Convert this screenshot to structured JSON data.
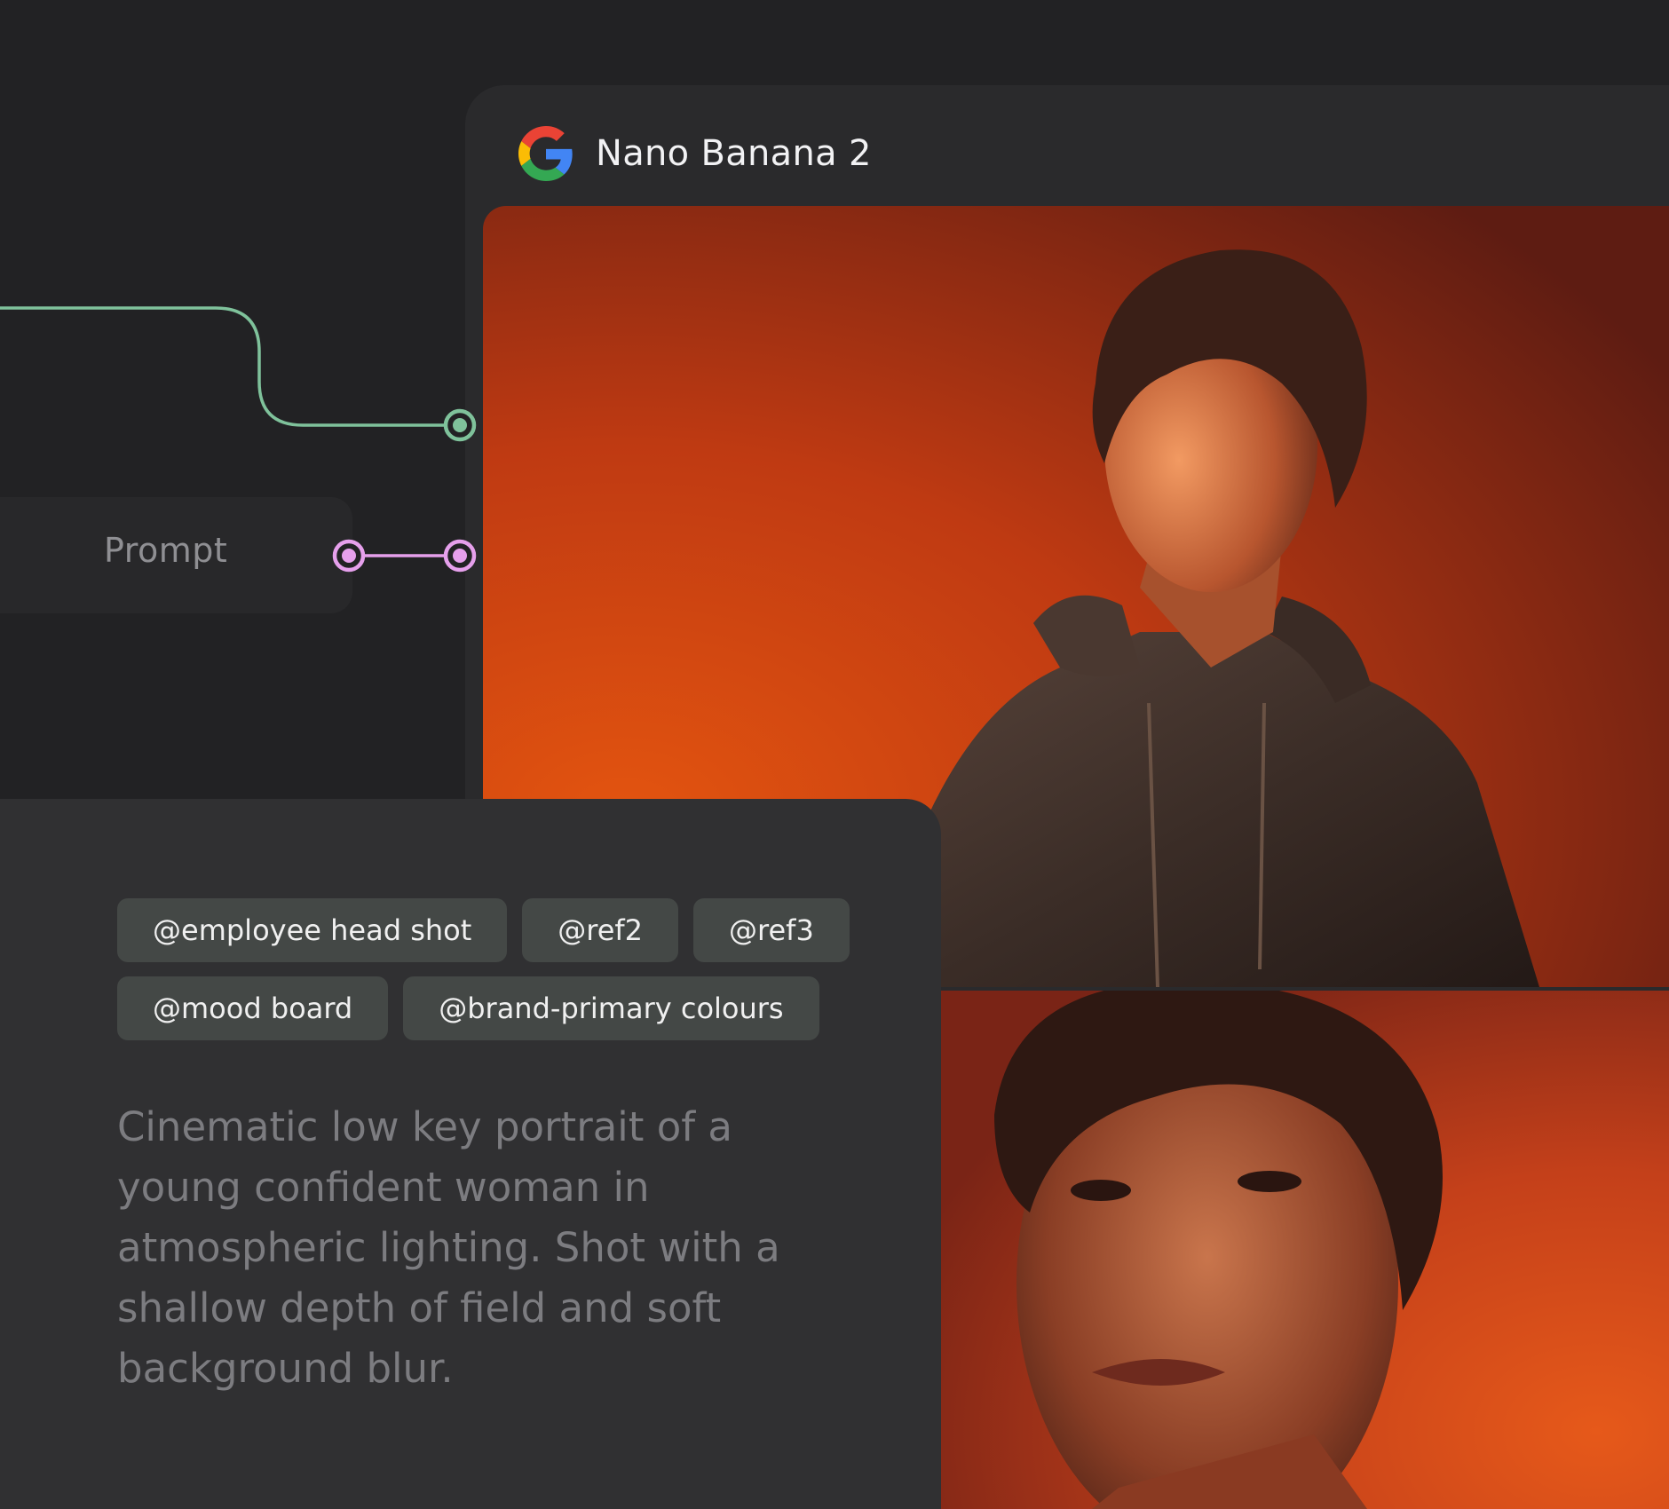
{
  "prompt_node": {
    "label": "Prompt"
  },
  "model_node": {
    "icon": "google-g-icon",
    "title": "Nano Banana 2"
  },
  "prompt_editor": {
    "references": [
      "@employee head shot",
      "@ref2",
      "@ref3",
      "@mood board",
      "@brand-primary colours"
    ],
    "prompt_text": "Cinematic low key portrait of a young confident woman in atmospheric lighting. Shot with a shallow depth of field and soft background blur."
  },
  "colors": {
    "canvas_background": "#222224",
    "image_wire": "#7fc29b",
    "prompt_wire": "#e6a0ec",
    "chip_background": "#444846",
    "model_card": "#2a2a2c",
    "output_orange": "#d9480f"
  }
}
